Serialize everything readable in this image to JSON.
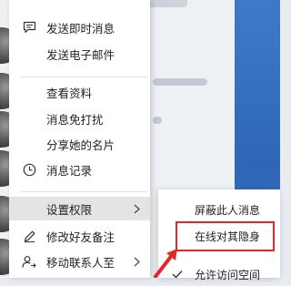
{
  "menu": {
    "items": [
      {
        "label": "发送即时消息",
        "icon": "chat-bubble-icon"
      },
      {
        "label": "发送电子邮件",
        "icon": ""
      },
      {
        "label": "查看资料",
        "icon": ""
      },
      {
        "label": "消息免打扰",
        "icon": ""
      },
      {
        "label": "分享她的名片",
        "icon": ""
      },
      {
        "label": "消息记录",
        "icon": "clock-icon"
      },
      {
        "label": "设置权限",
        "icon": "",
        "has_submenu": true
      },
      {
        "label": "修改好友备注",
        "icon": "pencil-icon"
      },
      {
        "label": "移动联系人至",
        "icon": "person-icon",
        "has_submenu": true
      }
    ]
  },
  "submenu": {
    "items": [
      {
        "label": "屏蔽此人消息"
      },
      {
        "label": "在线对其隐身"
      },
      {
        "label": "允许访问空间",
        "checked": true
      }
    ]
  },
  "colors": {
    "highlight_box": "#e3262a",
    "hover_bg": "#e4e4e4",
    "panel_blue": "#3a70bf"
  }
}
